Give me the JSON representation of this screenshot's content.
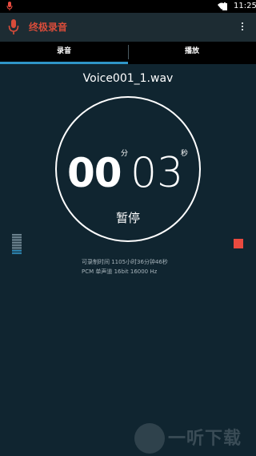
{
  "status_bar": {
    "time": "11:25",
    "icons": [
      "mic-icon",
      "wifi-icon",
      "battery-icon"
    ]
  },
  "app_bar": {
    "title": "终极录音",
    "title_color": "#d94c3a",
    "menu_icon": "overflow-menu-icon"
  },
  "tabs": [
    {
      "label": "录音",
      "active": true
    },
    {
      "label": "播放",
      "active": false
    }
  ],
  "recording": {
    "filename": "Voice001_1.wav",
    "minutes": "00",
    "minutes_unit": "分",
    "seconds": "03",
    "seconds_unit": "秒",
    "pause_label": "暂停",
    "remaining_time": "可录制时间 1105小时36分钟46秒",
    "format_info": "PCM 单声道 16bit 16000 Hz"
  },
  "level_meter": {
    "icon": "level-meter-icon",
    "bars": 13,
    "active_bars": 3
  },
  "stop_button": {
    "icon": "stop-icon",
    "color": "#e84a3f"
  },
  "watermark": {
    "text": "一听下载",
    "icon": "watermark-logo-icon"
  },
  "colors": {
    "background": "#102530",
    "app_bar": "#1d2c33",
    "accent_tab": "#2f96c8"
  }
}
